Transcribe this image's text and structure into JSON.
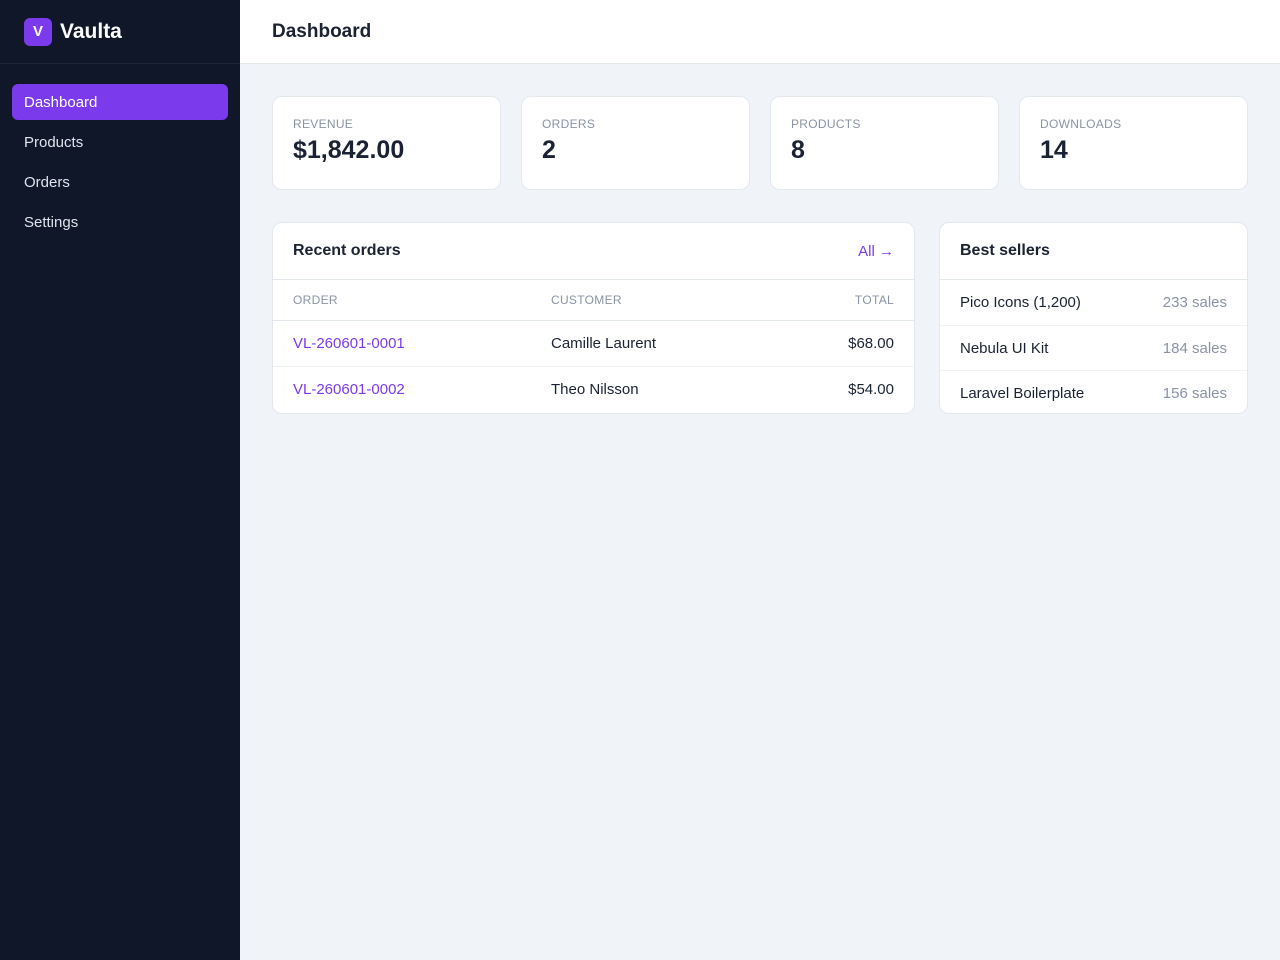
{
  "brand": {
    "logo_letter": "V",
    "name": "Vaulta"
  },
  "sidebar": {
    "items": [
      {
        "label": "Dashboard",
        "active": true
      },
      {
        "label": "Products",
        "active": false
      },
      {
        "label": "Orders",
        "active": false
      },
      {
        "label": "Settings",
        "active": false
      }
    ]
  },
  "header": {
    "title": "Dashboard"
  },
  "stats": [
    {
      "label": "REVENUE",
      "value": "$1,842.00"
    },
    {
      "label": "ORDERS",
      "value": "2"
    },
    {
      "label": "PRODUCTS",
      "value": "8"
    },
    {
      "label": "DOWNLOADS",
      "value": "14"
    }
  ],
  "recent_orders": {
    "title": "Recent orders",
    "link_label": "All →",
    "columns": [
      "ORDER",
      "CUSTOMER",
      "TOTAL"
    ],
    "rows": [
      {
        "order": "VL-260601-0001",
        "customer": "Camille Laurent",
        "total": "$68.00"
      },
      {
        "order": "VL-260601-0002",
        "customer": "Theo Nilsson",
        "total": "$54.00"
      }
    ]
  },
  "best_sellers": {
    "title": "Best sellers",
    "items": [
      {
        "name": "Pico Icons (1,200)",
        "sales": "233 sales"
      },
      {
        "name": "Nebula UI Kit",
        "sales": "184 sales"
      },
      {
        "name": "Laravel Boilerplate",
        "sales": "156 sales"
      }
    ]
  },
  "colors": {
    "accent": "#7c3aed",
    "sidebar_bg": "#101729",
    "page_bg": "#f0f3f8",
    "text": "#1a2233",
    "muted": "#8a93a6"
  }
}
